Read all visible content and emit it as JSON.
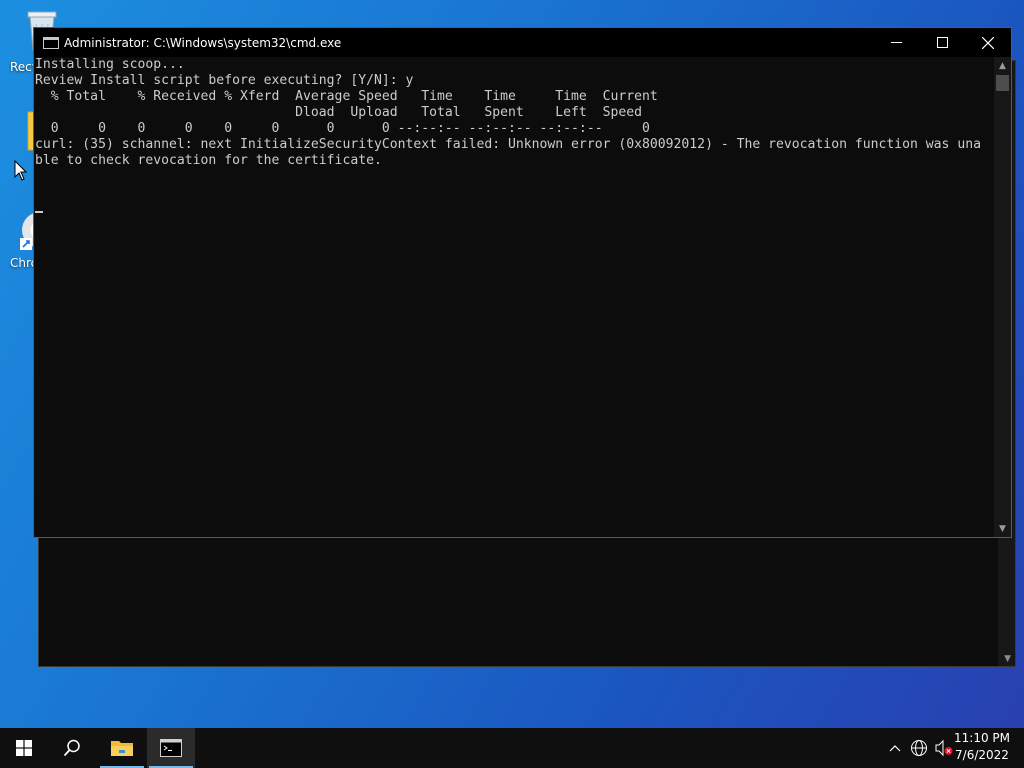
{
  "desktop": {
    "icons": [
      {
        "label": "Recy"
      },
      {
        "label": "Chro"
      }
    ]
  },
  "window": {
    "title": "Administrator: C:\\Windows\\system32\\cmd.exe",
    "console_lines": [
      "Installing scoop...",
      "Review Install script before executing? [Y/N]: y",
      "  % Total    % Received % Xferd  Average Speed   Time    Time     Time  Current",
      "                                 Dload  Upload   Total   Spent    Left  Speed",
      "",
      "  0     0    0     0    0     0      0      0 --:--:-- --:--:-- --:--:--     0",
      "curl: (35) schannel: next InitializeSecurityContext failed: Unknown error (0x80092012) - The revocation function was una",
      "ble to check revocation for the certificate."
    ]
  },
  "taskbar": {
    "clock_time": "11:10 PM",
    "clock_date": "7/6/2022"
  },
  "colors": {
    "console_bg": "#0c0c0c",
    "console_text": "#cccccc",
    "taskbar_bg": "#0f0f0f",
    "accent": "#76b9ed"
  }
}
